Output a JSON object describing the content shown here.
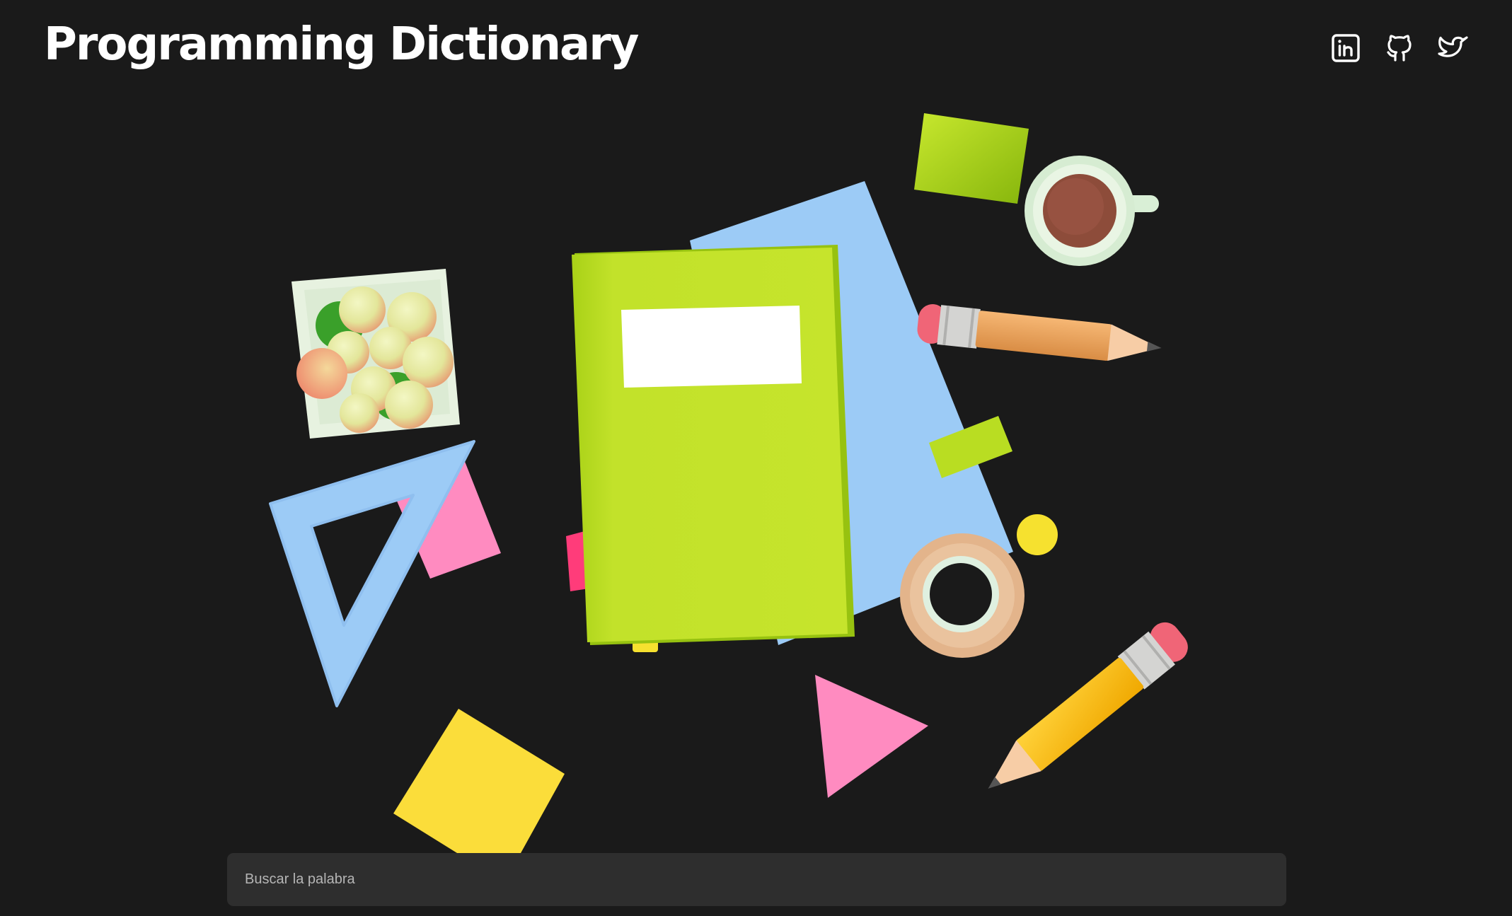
{
  "header": {
    "title": "Programming Dictionary"
  },
  "social": [
    {
      "name": "linkedin",
      "icon": "linkedin-icon"
    },
    {
      "name": "github",
      "icon": "github-icon"
    },
    {
      "name": "twitter",
      "icon": "twitter-icon"
    }
  ],
  "illustration": {
    "items": [
      "notebook",
      "blue-paper-sheet",
      "succulent-pot",
      "set-square-ruler",
      "coffee-cup",
      "pencil-orange",
      "pencil-yellow",
      "tape-roll",
      "sticky-note-yellow",
      "triangle-pink",
      "square-lime",
      "dot-yellow"
    ]
  },
  "search": {
    "placeholder": "Buscar la palabra",
    "value": ""
  },
  "colors": {
    "background": "#1a1a1a",
    "search_bg": "#2e2e2e",
    "lime": "#c2e22a",
    "blue": "#9cccf7",
    "pink": "#ff8fc4",
    "yellow": "#fbdd3a"
  }
}
